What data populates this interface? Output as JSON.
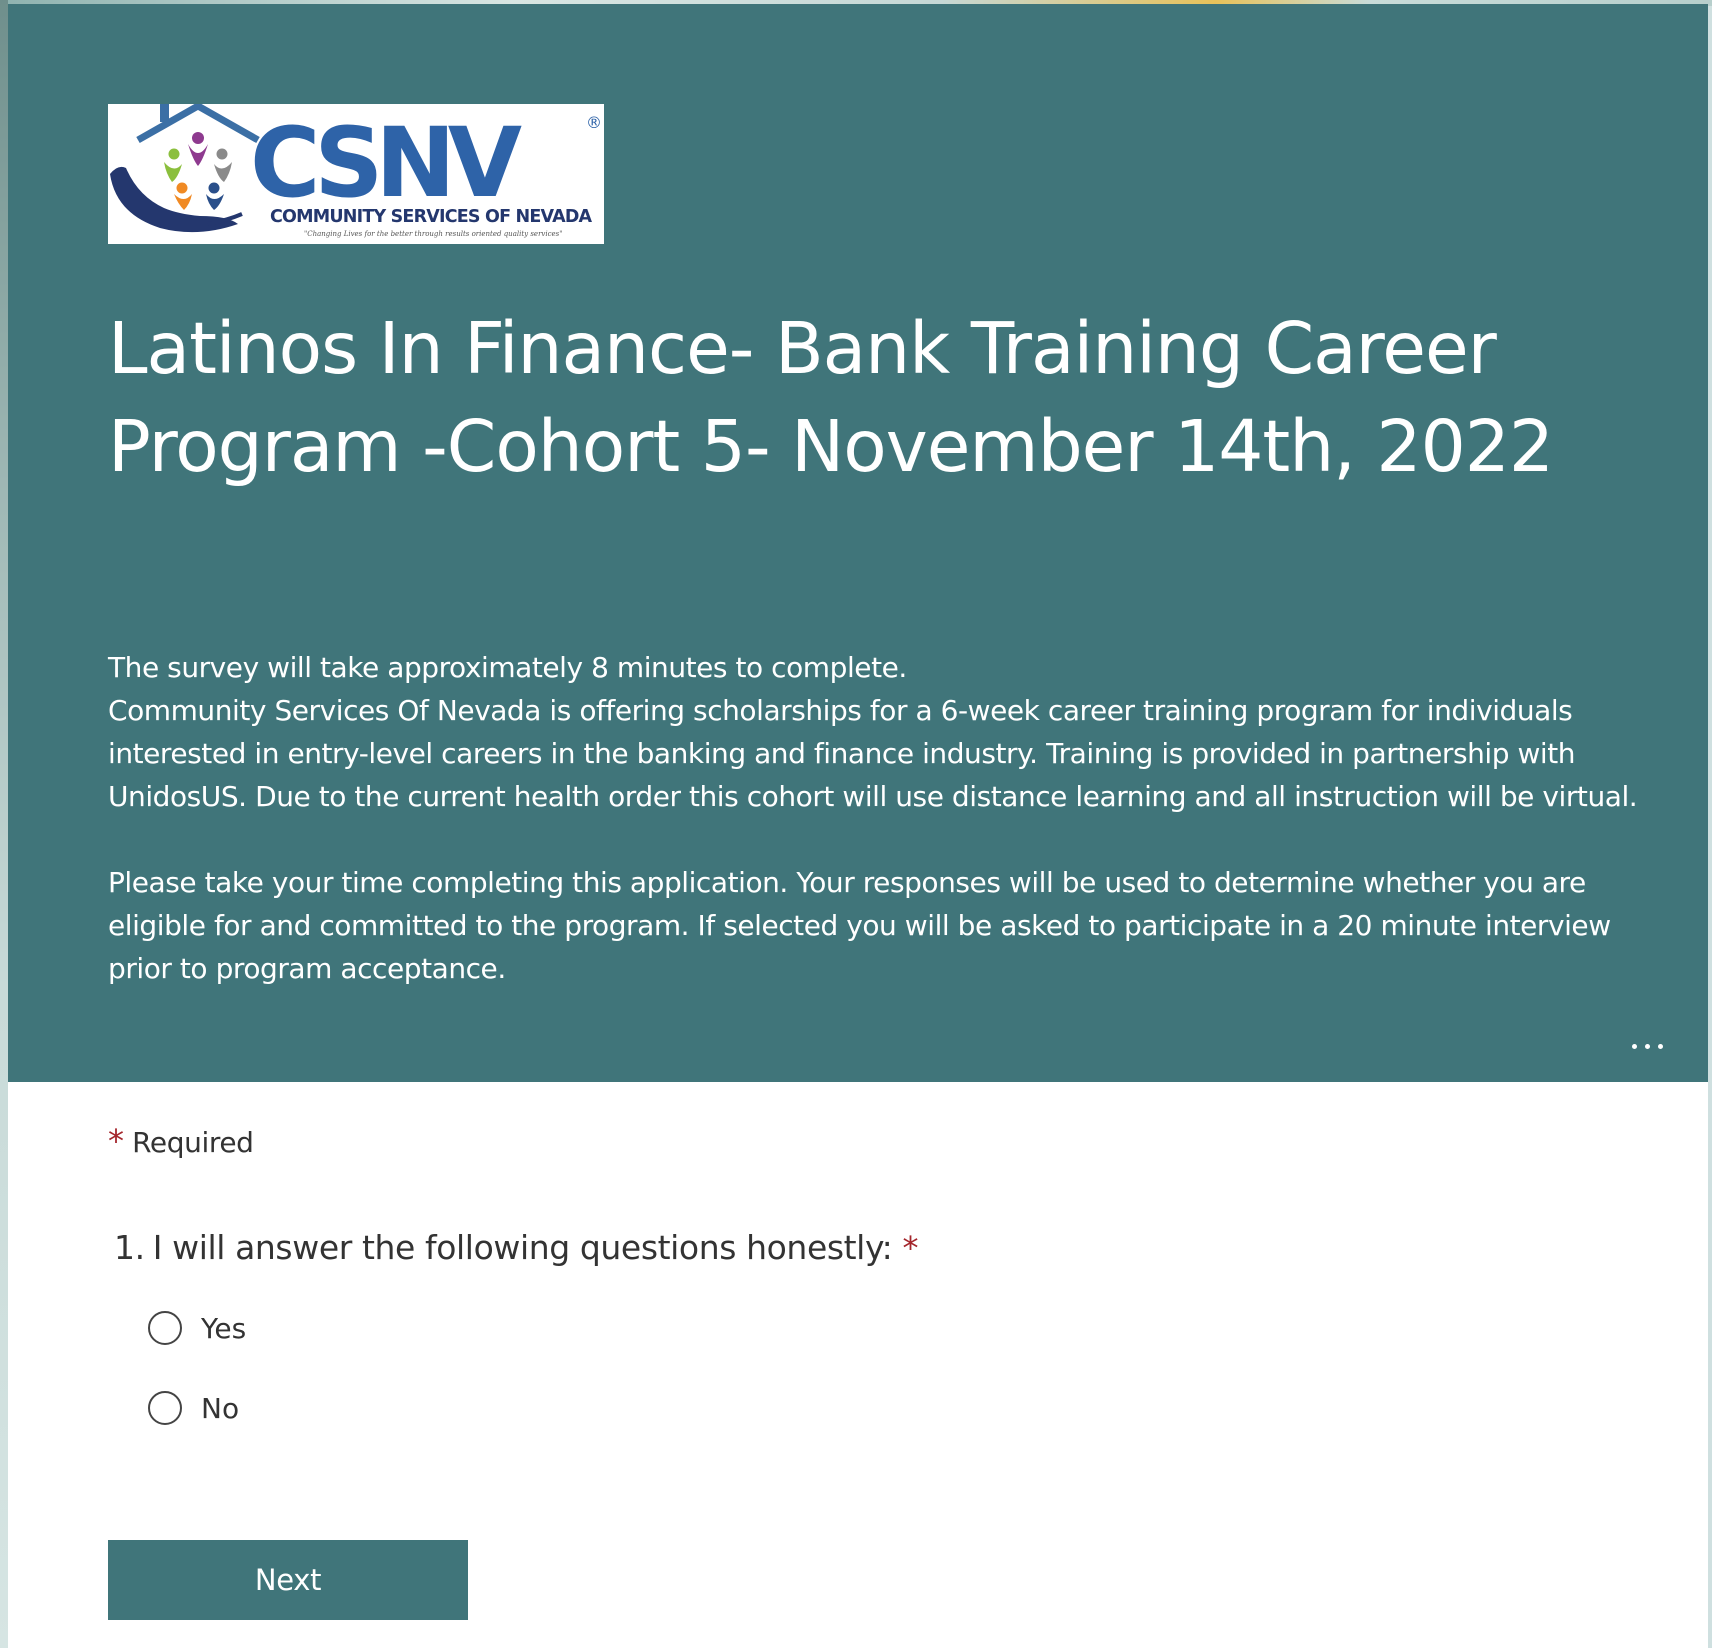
{
  "logo": {
    "text": "CSNV",
    "subtitle": "COMMUNITY SERVICES OF NEVADA",
    "tagline": "\"Changing Lives for the better through results oriented quality services\"",
    "registered": "®"
  },
  "header": {
    "title_line1": "Latinos In Finance- Bank Training Career",
    "title_line2": "Program -Cohort 5- November 14th, 2022",
    "description": {
      "line1": "The survey will take approximately 8 minutes to complete.",
      "line2": "Community Services Of Nevada is offering scholarships for a 6-week career training program for individuals",
      "line3": "interested in entry-level careers in the banking and finance industry. Training is provided in partnership with",
      "line4": "UnidosUS. Due to the current health order this cohort will use distance learning and all instruction will be virtual.",
      "line5": "Please take your time completing this application.  Your responses will be used to determine whether you are",
      "line6": "eligible for and committed to the program. If selected you will be asked to participate in a 20 minute interview",
      "line7": "prior to program acceptance."
    },
    "more_icon": "more-horizontal-icon"
  },
  "form": {
    "required_marker": "*",
    "required_text": "Required",
    "question": {
      "number": "1.",
      "text": "I will answer the following questions honestly:",
      "required_marker": "*",
      "options": [
        "Yes",
        "No"
      ],
      "selected": null
    },
    "next_label": "Next"
  },
  "colors": {
    "header_bg": "#40757a",
    "accent": "#40757a",
    "required": "#a4262c",
    "text": "#333333"
  }
}
